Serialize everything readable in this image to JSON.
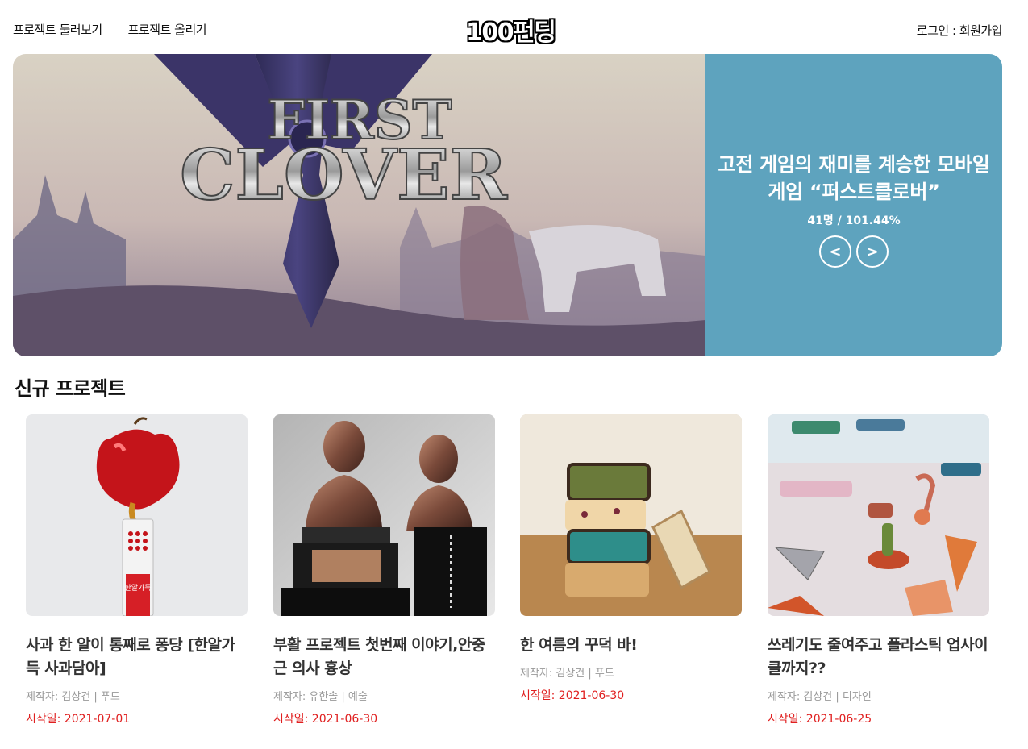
{
  "header": {
    "nav_browse": "프로젝트 둘러보기",
    "nav_upload": "프로젝트 올리기",
    "logo": "100펀딩",
    "auth": "로그인 : 회원가입"
  },
  "hero": {
    "title": "고전 게임의 재미를 계승한 모바일 게임 “퍼스트클로버”",
    "stats": "41명 / 101.44%",
    "image_text_line1": "FIRST",
    "image_text_line2": "CLOVER",
    "prev_label": "<",
    "next_label": ">",
    "panel_color": "#5ea3be"
  },
  "section": {
    "title": "신규 프로젝트"
  },
  "cards": [
    {
      "title": "사과 한 알이 통째로 퐁당 [한알가득 사과담아]",
      "meta": "제작자: 김상건 | 푸드",
      "date": "시작일: 2021-07-01",
      "packet_text": "한알가득"
    },
    {
      "title": "부활 프로젝트 첫번째 이야기,안중근 의사 흉상",
      "meta": "제작자: 유한솔 | 예술",
      "date": "시작일: 2021-06-30"
    },
    {
      "title": "한 여름의 꾸덕 바!",
      "meta": "제작자: 김상건 | 푸드",
      "date": "시작일: 2021-06-30"
    },
    {
      "title": "쓰레기도 줄여주고 플라스틱 업사이클까지??",
      "meta": "제작자: 김상건 | 디자인",
      "date": "시작일: 2021-06-25"
    }
  ],
  "colors": {
    "accent_date": "#e02020",
    "meta_gray": "#999999"
  }
}
